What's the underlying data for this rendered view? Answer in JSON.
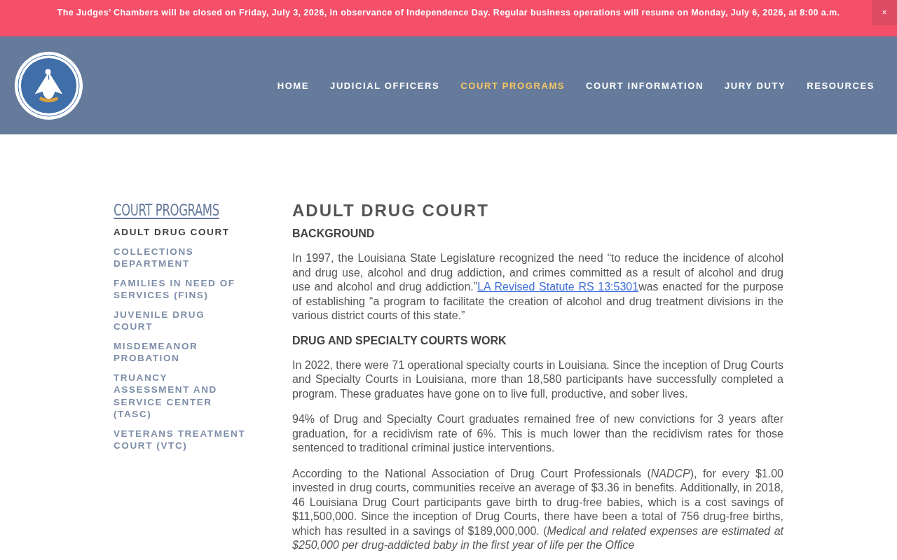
{
  "banner": {
    "text": "The Judges’ Chambers will be closed on Friday, July 3, 2026, in observance of Independence Day. Regular business operations will resume on Monday, July 6, 2026, at 8:00 a.m.",
    "close": "×"
  },
  "nav": [
    {
      "label": "HOME",
      "selected": false
    },
    {
      "label": "JUDICIAL OFFICERS",
      "selected": false
    },
    {
      "label": "COURT PROGRAMS",
      "selected": true
    },
    {
      "label": "COURT INFORMATION",
      "selected": false
    },
    {
      "label": "JURY DUTY",
      "selected": false
    },
    {
      "label": "RESOURCES",
      "selected": false
    }
  ],
  "sidebar": {
    "title": "COURT PROGRAMS",
    "items": [
      {
        "label": "ADULT DRUG COURT",
        "selected": true
      },
      {
        "label": "COLLECTIONS DEPARTMENT",
        "selected": false
      },
      {
        "label": "FAMILIES IN NEED OF SERVICES (FINS)",
        "selected": false
      },
      {
        "label": "JUVENILE DRUG COURT",
        "selected": false
      },
      {
        "label": "MISDEMEANOR PROBATION",
        "selected": false
      },
      {
        "label": "TRUANCY ASSESSMENT AND SERVICE CENTER (TASC)",
        "selected": false
      },
      {
        "label": "VETERANS TREATMENT COURT (VTC)",
        "selected": false
      }
    ]
  },
  "article": {
    "title": "ADULT DRUG COURT",
    "blocks": [
      {
        "kind": "heading",
        "text": "BACKGROUND"
      },
      {
        "kind": "paragraph",
        "text": "In 1997, the Louisiana State Legislature recognized the need “to reduce the incidence of alcohol and drug use, alcohol and drug addiction, and crimes committed as a result of alcohol and drug use and alcohol and drug addiction.”",
        "link": "LA Revised Statute RS 13:5301",
        "after": "was enacted for the purpose of establishing “a program to facilitate the creation of alcohol and drug treatment divisions in the various district courts of this state.”"
      },
      {
        "kind": "heading",
        "text": "DRUG AND SPECIALTY COURTS WORK"
      },
      {
        "kind": "paragraph",
        "text": "In 2022, there were 71 operational specialty courts in Louisiana. Since the inception of Drug Courts and Specialty Courts in Louisiana, more than 18,580 participants have successfully completed a program.  These graduates have gone on to live full, productive, and sober lives."
      },
      {
        "kind": "paragraph",
        "text": "94% of Drug and Specialty Court graduates remained free of new convictions for 3 years after graduation, for a recidivism rate of 6%.  This is much lower than the recidivism rates for those sentenced to traditional criminal justice interventions."
      },
      {
        "kind": "paragraph",
        "text": "According to the National Association of Drug Court Professionals (*NADCP*), for every $1.00 invested in drug courts, communities receive an average of $3.36 in benefits.  Additionally, in 2018, 46 Louisiana Drug Court participants gave birth to drug-free babies, which is a cost savings of $11,500,000.  Since the inception of Drug Courts, there have been a total of 756 drug-free births, which has resulted in a savings of $189,000,000. (*Medical and related expenses are estimated at $250,000 per drug-addicted baby in the first year of life per the Office*"
      }
    ]
  }
}
